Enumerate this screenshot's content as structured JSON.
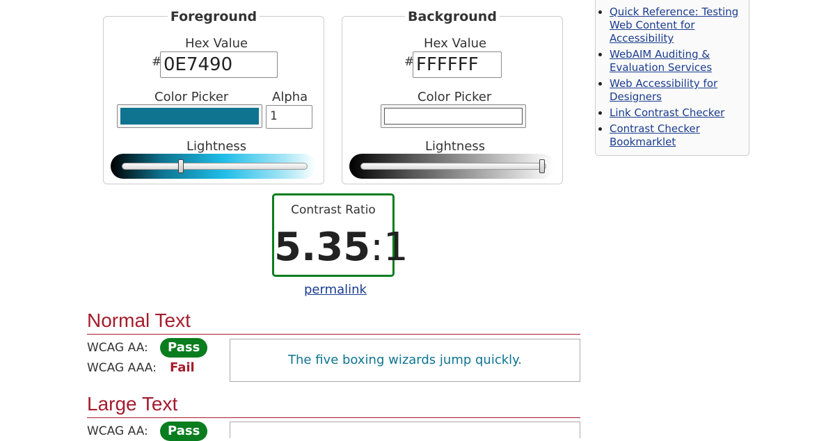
{
  "foreground": {
    "legend": "Foreground",
    "hex_label": "Hex Value",
    "hash": "#",
    "hex_value": "0E7490",
    "picker_label": "Color Picker",
    "alpha_label": "Alpha",
    "alpha_value": "1",
    "lightness_label": "Lightness",
    "color": "#0E7490"
  },
  "background": {
    "legend": "Background",
    "hex_label": "Hex Value",
    "hash": "#",
    "hex_value": "FFFFFF",
    "picker_label": "Color Picker",
    "lightness_label": "Lightness",
    "color": "#FFFFFF"
  },
  "contrast": {
    "label": "Contrast Ratio",
    "ratio_main": "5.35",
    "ratio_suffix": ":1",
    "permalink": "permalink"
  },
  "normal_text": {
    "heading": "Normal Text",
    "aa_label": "WCAG AA:",
    "aa_result": "Pass",
    "aaa_label": "WCAG AAA:",
    "aaa_result": "Fail",
    "sample": "The five boxing wizards jump quickly."
  },
  "large_text": {
    "heading": "Large Text",
    "aa_label": "WCAG AA:",
    "aa_result": "Pass"
  },
  "sidebar": {
    "links": [
      "Quick Reference: Testing Web Content for Accessibility",
      "WebAIM Auditing & Evaluation Services",
      "Web Accessibility for Designers",
      "Link Contrast Checker",
      "Contrast Checker Bookmarklet"
    ]
  },
  "colors": {
    "pass": "#0a7d1f",
    "fail": "#a41c2c",
    "heading": "#a41c2c",
    "link": "#1a3c8e"
  }
}
